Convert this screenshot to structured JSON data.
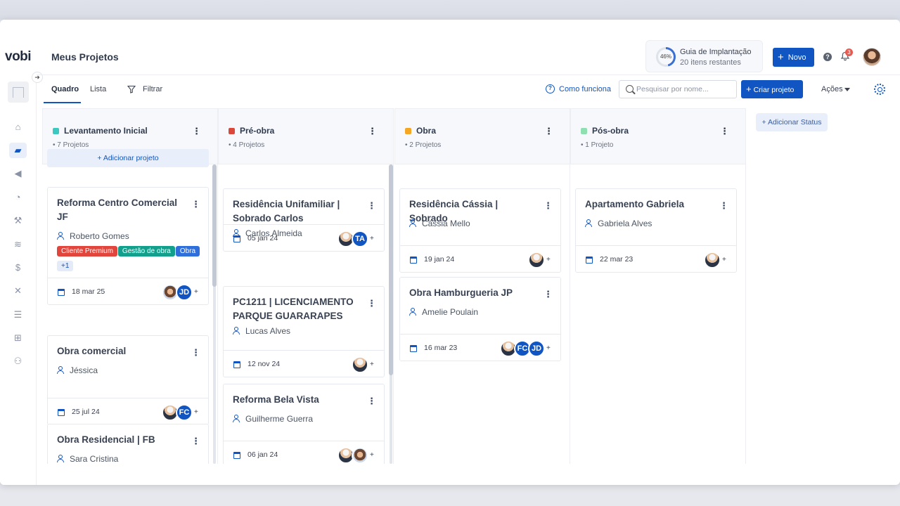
{
  "app": {
    "logo": "vobi",
    "page_title": "Meus Projetos"
  },
  "header": {
    "guide": {
      "percent_label": "46%",
      "percent": 46,
      "title": "Guia de Implantação",
      "subtitle": "20 itens restantes"
    },
    "new_button": "Novo",
    "notifications_count": "3",
    "icons": [
      "help-icon",
      "bell-icon",
      "user-avatar"
    ]
  },
  "sidebar": {
    "items": [
      "home-icon",
      "folder-icon",
      "megaphone-icon",
      "gauge-icon",
      "worker-icon",
      "coins-icon",
      "dollar-icon",
      "tools-icon",
      "list-icon",
      "apps-icon",
      "team-icon"
    ],
    "active": "folder-icon"
  },
  "toolbar": {
    "tabs": [
      "Quadro",
      "Lista"
    ],
    "active_tab": "Quadro",
    "filter": "Filtrar",
    "how_it_works": "Como funciona",
    "search_placeholder": "Pesquisar por nome...",
    "create_button": "Criar projeto",
    "actions": "Ações"
  },
  "board": {
    "add_status": "+ Adicionar Status",
    "add_project": "+ Adicionar projeto",
    "columns": [
      {
        "title": "Levantamento Inicial",
        "count": "• 7 Projetos",
        "color": "#3cc7c0",
        "cards": [
          {
            "title": "Reforma Centro Comercial JF",
            "owner": "Roberto Gomes",
            "date": "18 mar 25",
            "tags": [
              {
                "label": "Cliente Premium",
                "color": "#e2453c"
              },
              {
                "label": "Gestão de obra",
                "color": "#12a08c"
              },
              {
                "label": "Obra",
                "color": "#2f6fdc"
              },
              {
                "label": "+1",
                "color": "#e3ebf9"
              }
            ],
            "avatars": [
              "woman",
              "JD"
            ]
          },
          {
            "title": "Obra comercial",
            "owner": "Jéssica",
            "date": "25 jul 24",
            "avatars": [
              "worker",
              "FC"
            ]
          },
          {
            "title": "Obra Residencial | FB",
            "owner": "Sara Cristina"
          }
        ]
      },
      {
        "title": "Pré-obra",
        "count": "• 4 Projetos",
        "color": "#d9483b",
        "cards": [
          {
            "title": "Residência Unifamiliar | Sobrado Carlos",
            "owner": "Carlos Almeida",
            "date": "05 jan 24",
            "avatars": [
              "worker",
              "TA"
            ]
          },
          {
            "title": "PC1211 | LICENCIAMENTO PARQUE GUARARAPES",
            "owner": "Lucas Alves",
            "date": "12 nov 24",
            "avatars": [
              "worker"
            ]
          },
          {
            "title": "Reforma Bela Vista",
            "owner": "Guilherme Guerra",
            "date": "06 jan 24",
            "avatars": [
              "worker",
              "woman"
            ]
          }
        ]
      },
      {
        "title": "Obra",
        "count": "• 2 Projetos",
        "color": "#f5a623",
        "cards": [
          {
            "title": "Residência Cássia | Sobrado",
            "owner": "Cássia Mello",
            "date": "19 jan 24",
            "avatars": [
              "worker"
            ]
          },
          {
            "title": "Obra Hamburgueria JP",
            "owner": "Amelie Poulain",
            "date": "16 mar 23",
            "avatars": [
              "worker",
              "FC",
              "JD"
            ]
          }
        ]
      },
      {
        "title": "Pós-obra",
        "count": "• 1 Projeto",
        "color": "#8ee0b0",
        "cards": [
          {
            "title": "Apartamento Gabriela",
            "owner": "Gabriela Alves",
            "date": "22 mar 23",
            "avatars": [
              "worker"
            ]
          }
        ]
      }
    ]
  },
  "colors": {
    "primary": "#1055c1",
    "bg": "#ffffff",
    "column_header_bg": "#f7f8fb"
  }
}
